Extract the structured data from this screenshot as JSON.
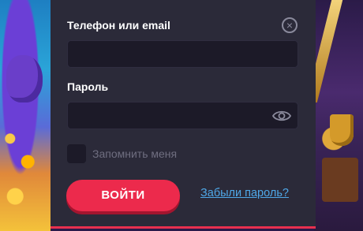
{
  "form": {
    "phone_label": "Телефон или email",
    "phone_value": "",
    "password_label": "Пароль",
    "password_value": "",
    "remember_label": "Запомнить меня",
    "remember_checked": false,
    "login_label": "ВОЙТИ",
    "forgot_label": "Забыли пароль?"
  },
  "icons": {
    "close": "close-icon",
    "show_password": "eye-icon"
  },
  "colors": {
    "panel_bg": "#2b2a39",
    "input_bg": "#1c1a28",
    "accent": "#ec2a4c",
    "link": "#4fa8e8",
    "muted_text": "#6f6e80"
  }
}
